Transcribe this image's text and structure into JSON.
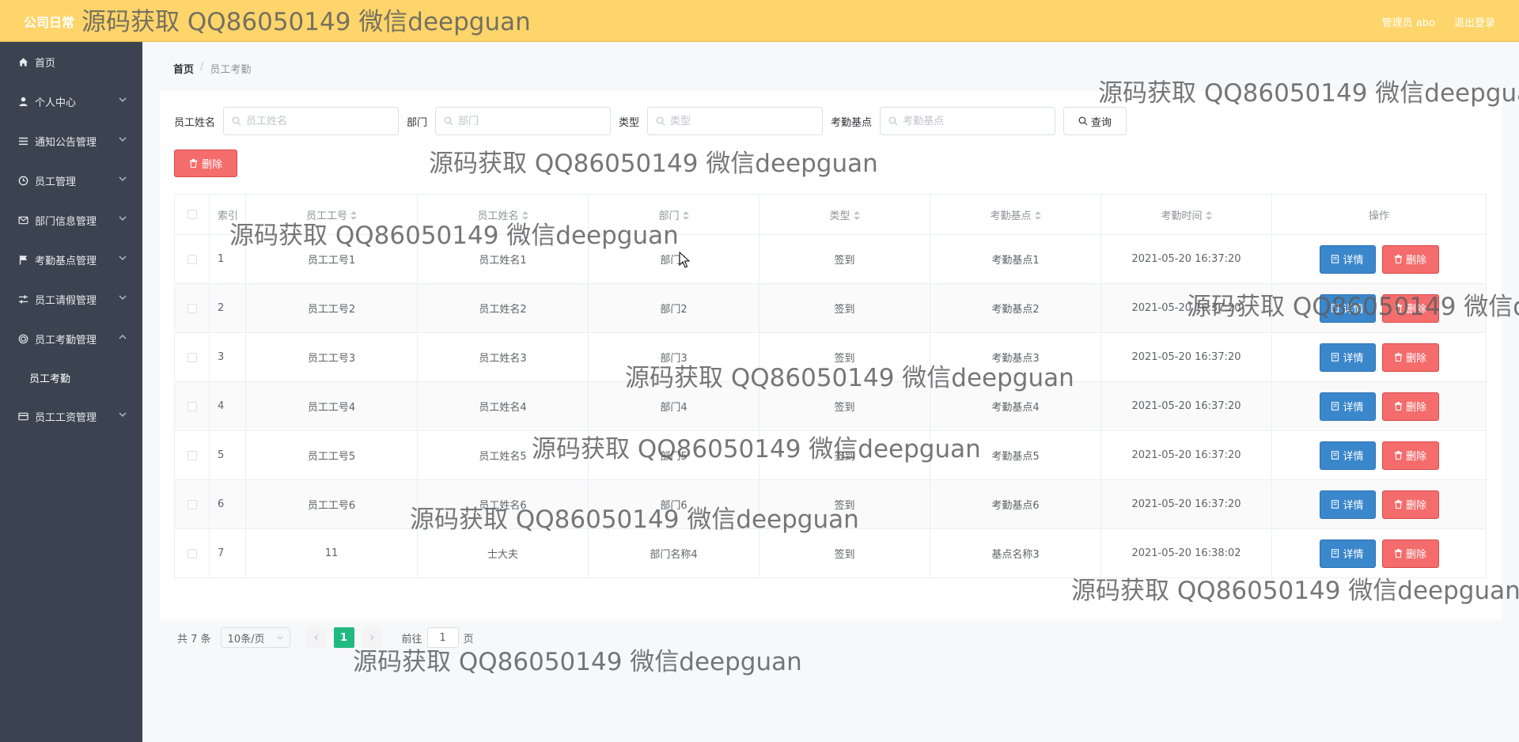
{
  "header": {
    "app_title": "公司日常",
    "user_label": "管理员 abo",
    "logout_label": "退出登录"
  },
  "sidebar": {
    "items": [
      {
        "label": "首页"
      },
      {
        "label": "个人中心"
      },
      {
        "label": "通知公告管理"
      },
      {
        "label": "员工管理"
      },
      {
        "label": "部门信息管理"
      },
      {
        "label": "考勤基点管理"
      },
      {
        "label": "员工请假管理"
      },
      {
        "label": "员工考勤管理"
      },
      {
        "label": "员工工资管理"
      }
    ],
    "sub_item": "员工考勤"
  },
  "breadcrumb": {
    "home": "首页",
    "separator": "/",
    "current": "员工考勤"
  },
  "search": {
    "name_label": "员工姓名",
    "name_placeholder": "员工姓名",
    "dept_label": "部门",
    "dept_placeholder": "部门",
    "type_label": "类型",
    "type_placeholder": "类型",
    "base_label": "考勤基点",
    "base_placeholder": "考勤基点",
    "query_label": "查询"
  },
  "toolbar": {
    "delete_label": "删除"
  },
  "table": {
    "headers": [
      "索引",
      "员工工号",
      "员工姓名",
      "部门",
      "类型",
      "考勤基点",
      "考勤时间",
      "操作"
    ],
    "detail_label": "详情",
    "delete_label": "删除",
    "rows": [
      [
        "1",
        "员工工号1",
        "员工姓名1",
        "部门1",
        "签到",
        "考勤基点1",
        "2021-05-20 16:37:20"
      ],
      [
        "2",
        "员工工号2",
        "员工姓名2",
        "部门2",
        "签到",
        "考勤基点2",
        "2021-05-20 16:37:20"
      ],
      [
        "3",
        "员工工号3",
        "员工姓名3",
        "部门3",
        "签到",
        "考勤基点3",
        "2021-05-20 16:37:20"
      ],
      [
        "4",
        "员工工号4",
        "员工姓名4",
        "部门4",
        "签到",
        "考勤基点4",
        "2021-05-20 16:37:20"
      ],
      [
        "5",
        "员工工号5",
        "员工姓名5",
        "部门5",
        "签到",
        "考勤基点5",
        "2021-05-20 16:37:20"
      ],
      [
        "6",
        "员工工号6",
        "员工姓名6",
        "部门6",
        "签到",
        "考勤基点6",
        "2021-05-20 16:37:20"
      ],
      [
        "7",
        "11",
        "士大夫",
        "部门名称4",
        "签到",
        "基点名称3",
        "2021-05-20 16:38:02"
      ]
    ]
  },
  "pagination": {
    "total": "共 7 条",
    "page_size": "10条/页",
    "current_page": "1",
    "goto_prefix": "前往",
    "goto_value": "1",
    "goto_suffix": "页"
  },
  "watermark": "源码获取 QQ86050149 微信deepguan",
  "colors": {
    "topbar": "#fdd56a",
    "sidebar": "#3b4350",
    "detail_button": "#3a87cc",
    "delete_button": "#f56c6c",
    "active_page": "#21b980"
  },
  "icons": {
    "sidebar": [
      "home-icon",
      "user-icon",
      "list-icon",
      "clock-icon",
      "message-icon",
      "flag-icon",
      "sliders-icon",
      "circle-icon",
      "card-icon"
    ],
    "search": "search-icon",
    "delete": "trash-icon",
    "detail": "document-icon"
  }
}
